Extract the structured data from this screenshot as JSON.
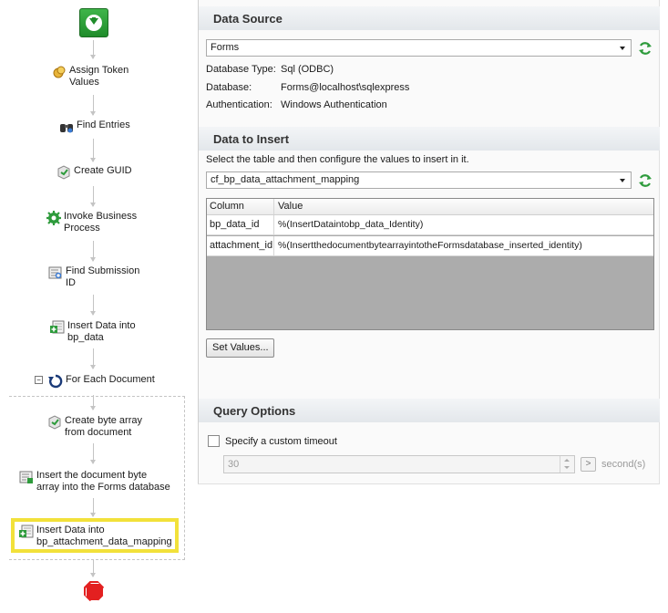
{
  "workflow": {
    "steps": [
      {
        "label": "Assign Token\nValues",
        "icon": "token-icon"
      },
      {
        "label": "Find Entries",
        "icon": "binoculars-icon"
      },
      {
        "label": "Create GUID",
        "icon": "guid-icon"
      },
      {
        "label": "Invoke Business\nProcess",
        "icon": "gear-icon"
      },
      {
        "label": "Find Submission\nID",
        "icon": "form-search-icon"
      },
      {
        "label": "Insert Data into\nbp_data",
        "icon": "insert-data-icon"
      },
      {
        "label": "For Each Document",
        "icon": "loop-icon"
      },
      {
        "label": "Create byte array\nfrom document",
        "icon": "script-icon"
      },
      {
        "label": "Insert the document byte\narray into the Forms database",
        "icon": "form-insert-icon"
      },
      {
        "label": "Insert Data into\nbp_attachment_data_mapping",
        "icon": "insert-data-icon"
      }
    ],
    "collapse_symbol": "−",
    "selected_index": 9,
    "colors": {
      "selected_outline": "#f2e13a",
      "start": "#1f8c2a",
      "stop": "#e32020"
    }
  },
  "data_source": {
    "heading": "Data Source",
    "connection": "Forms",
    "type_label": "Database Type:",
    "type_value": "Sql (ODBC)",
    "db_label": "Database:",
    "db_value": "Forms@localhost\\sqlexpress",
    "auth_label": "Authentication:",
    "auth_value": "Windows Authentication"
  },
  "data_to_insert": {
    "heading": "Data to Insert",
    "instruction": "Select the table and then configure the values to insert in it.",
    "table": "cf_bp_data_attachment_mapping",
    "columns": [
      "Column",
      "Value"
    ],
    "rows": [
      {
        "column": "bp_data_id",
        "value": "%(InsertDataintobp_data_Identity)"
      },
      {
        "column": "attachment_id",
        "value": "%(InsertthedocumentbytearrayintotheFormsdatabase_inserted_identity)"
      }
    ],
    "set_values_label": "Set Values..."
  },
  "query_options": {
    "heading": "Query Options",
    "timeout_label": "Specify a custom timeout",
    "timeout_value": "30",
    "unit_label": "second(s)",
    "go_label": ">"
  }
}
